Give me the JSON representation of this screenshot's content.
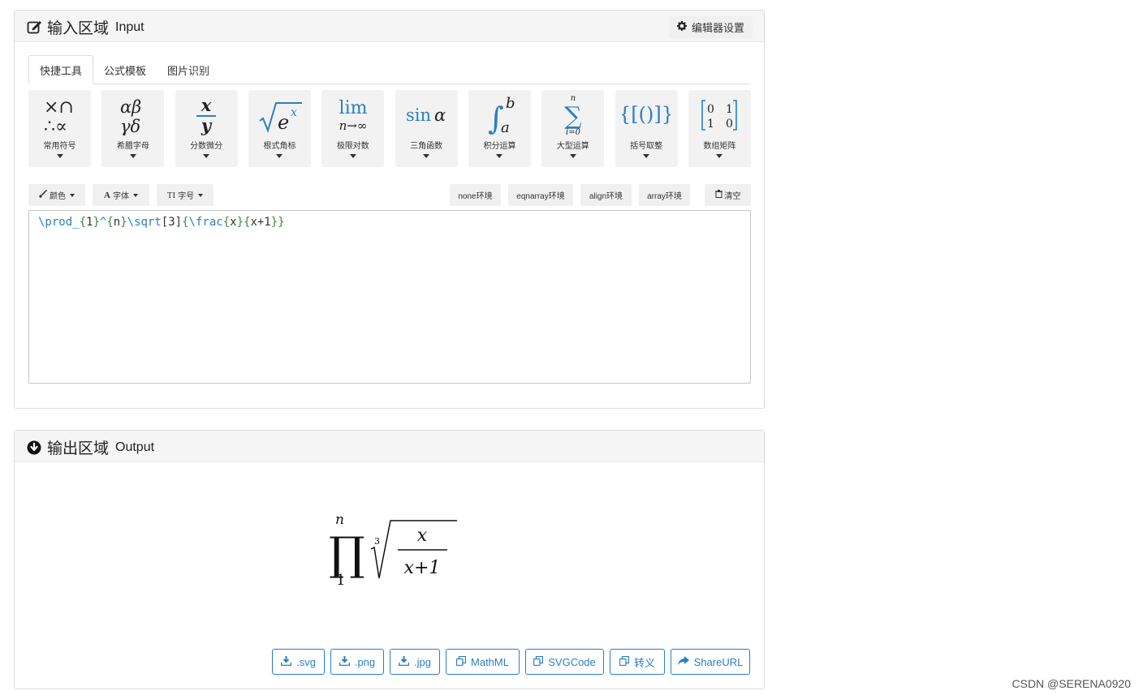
{
  "input_panel": {
    "title_cn": "输入区域",
    "title_en": "Input",
    "settings_label": "编辑器设置",
    "tabs": [
      {
        "label": "快捷工具"
      },
      {
        "label": "公式模板"
      },
      {
        "label": "图片识别"
      }
    ],
    "tools": [
      {
        "label": "常用符号",
        "icon": "common-symbols-icon"
      },
      {
        "label": "希腊字母",
        "icon": "greek-letters-icon"
      },
      {
        "label": "分数微分",
        "icon": "fraction-icon"
      },
      {
        "label": "根式角标",
        "icon": "radical-icon"
      },
      {
        "label": "极限对数",
        "icon": "limit-icon"
      },
      {
        "label": "三角函数",
        "icon": "trig-icon"
      },
      {
        "label": "积分运算",
        "icon": "integral-icon"
      },
      {
        "label": "大型运算",
        "icon": "sum-icon"
      },
      {
        "label": "括号取整",
        "icon": "brackets-icon"
      },
      {
        "label": "数组矩阵",
        "icon": "matrix-icon"
      }
    ],
    "tool_symbols": {
      "s1a": "×∩",
      "s1b": "∴∝",
      "s2a": "αβ",
      "s2b": "γδ",
      "s3a": "x",
      "s3b": "y",
      "s4": "e",
      "s4sup": "x",
      "s5a": "lim",
      "s5b": "n→∞",
      "s6a": "sin",
      "s6b": "α",
      "s7": "∫",
      "s7up": "b",
      "s7low": "a",
      "s8top": "n",
      "s8": "∑",
      "s8bot": "i=0",
      "s9": "{[()]}",
      "s10": [
        "0",
        "1",
        "1",
        "0"
      ]
    },
    "format_buttons": {
      "color": "颜色",
      "font": "字体",
      "size": "字号",
      "font_glyph": "A",
      "size_glyph": "TI"
    },
    "env_buttons": [
      "none环境",
      "eqnarray环境",
      "align环境",
      "array环境"
    ],
    "clear_label": "清空",
    "editor_parts": [
      {
        "text": "\\prod_",
        "kind": "cmd"
      },
      {
        "text": "{",
        "kind": "brace"
      },
      {
        "text": "1",
        "kind": "txt"
      },
      {
        "text": "}",
        "kind": "brace"
      },
      {
        "text": "^",
        "kind": "cmd"
      },
      {
        "text": "{",
        "kind": "brace"
      },
      {
        "text": "n",
        "kind": "txt"
      },
      {
        "text": "}",
        "kind": "brace"
      },
      {
        "text": "\\sqrt",
        "kind": "cmd"
      },
      {
        "text": "[3]",
        "kind": "txt"
      },
      {
        "text": "{",
        "kind": "brace"
      },
      {
        "text": "\\frac",
        "kind": "cmd"
      },
      {
        "text": "{",
        "kind": "brace"
      },
      {
        "text": "x",
        "kind": "txt"
      },
      {
        "text": "}",
        "kind": "brace"
      },
      {
        "text": "{",
        "kind": "brace"
      },
      {
        "text": "x+1",
        "kind": "txt"
      },
      {
        "text": "}}",
        "kind": "brace"
      }
    ]
  },
  "output_panel": {
    "title_cn": "输出区域",
    "title_en": "Output",
    "formula": {
      "prod": "∏",
      "upper": "n",
      "lower": "1",
      "index": "3",
      "num": "x",
      "den": "x+1"
    },
    "downloads": [
      {
        "label": ".svg",
        "icon": "download-icon"
      },
      {
        "label": ".png",
        "icon": "download-icon"
      },
      {
        "label": ".jpg",
        "icon": "download-icon"
      },
      {
        "label": "MathML",
        "icon": "copy-icon"
      },
      {
        "label": "SVGCode",
        "icon": "copy-icon"
      },
      {
        "label": "转义",
        "icon": "copy-icon"
      },
      {
        "label": "ShareURL",
        "icon": "share-icon"
      }
    ]
  },
  "watermark": "CSDN @SERENA0920",
  "colors": {
    "accent": "#2a7fc4",
    "brace": "#3c8a3c",
    "tool_bg": "#f2f2f2"
  }
}
